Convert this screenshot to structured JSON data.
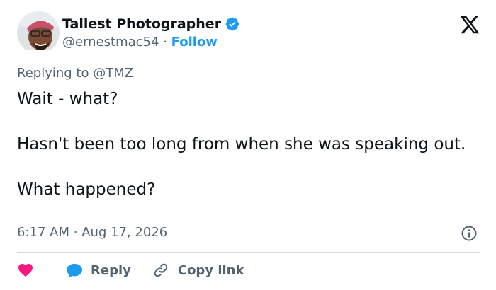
{
  "author": {
    "display_name": "Tallest Photographer",
    "handle": "@ernestmac54",
    "separator": "·",
    "follow_label": "Follow"
  },
  "reply_context": {
    "prefix": "Replying to",
    "mention": "@TMZ"
  },
  "tweet": {
    "lines": [
      "Wait - what?",
      "Hasn't been too long from when she was speaking out.",
      "What happened?"
    ]
  },
  "meta": {
    "time": "6:17 AM",
    "separator": "·",
    "date": "Aug 17, 2026"
  },
  "actions": {
    "reply_label": "Reply",
    "copy_link_label": "Copy link"
  },
  "icons": {
    "verified": "verified-badge-icon",
    "brand": "x-logo-icon",
    "info": "info-icon",
    "like": "heart-icon",
    "reply": "chat-bubble-icon",
    "copy": "link-icon"
  },
  "colors": {
    "text": "#0f1419",
    "secondary": "#536471",
    "accent": "#1d9bf0",
    "heart": "#f91880",
    "divider": "#cfd9de"
  }
}
